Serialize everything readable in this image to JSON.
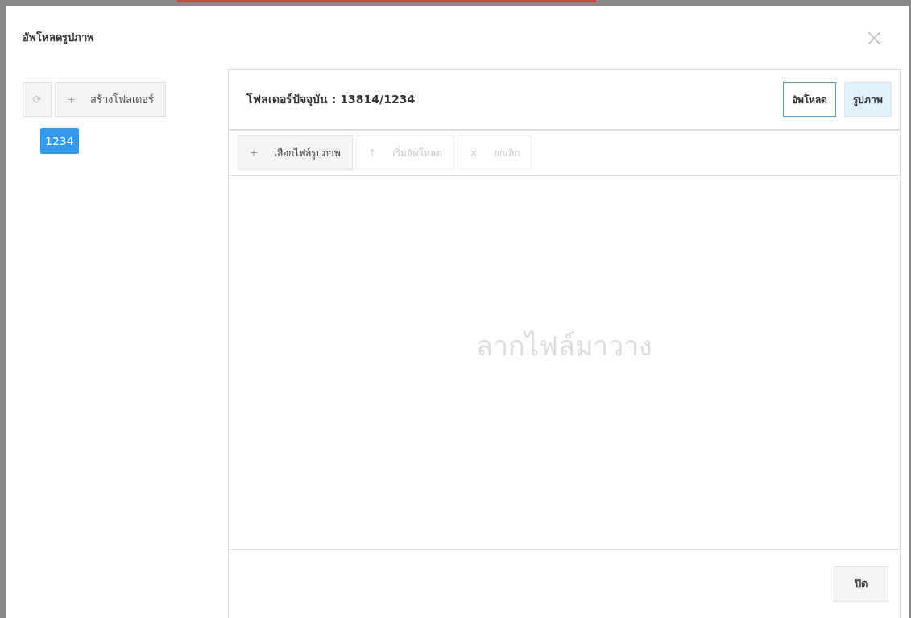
{
  "dialog": {
    "title": "อัพโหลดรูปภาพ",
    "close": "×"
  },
  "sidebar": {
    "refresh": "⟳",
    "new_folder": {
      "icon": "+",
      "label": "สร้างโฟลเดอร์"
    },
    "folders": [
      {
        "label": "1234",
        "selected": true
      }
    ]
  },
  "panel": {
    "current_folder": "โฟลเดอร์ปัจจุบัน : 13814/1234",
    "tabs": [
      {
        "label": "อัพโหลด",
        "selected": true
      },
      {
        "label": "รูปภาพ",
        "selected": false
      }
    ],
    "toolbar": [
      {
        "icon": "+",
        "label": "เลือกไฟล์รูปภาพ",
        "disabled": false
      },
      {
        "icon": "↑",
        "label": "เริ่มอัพโหลด",
        "disabled": true
      },
      {
        "icon": "×",
        "label": "ยกเลิก",
        "disabled": true
      }
    ],
    "drop_hint": "ลากไฟล์มาวาง"
  },
  "footer": {
    "close_button": "ปิด"
  }
}
